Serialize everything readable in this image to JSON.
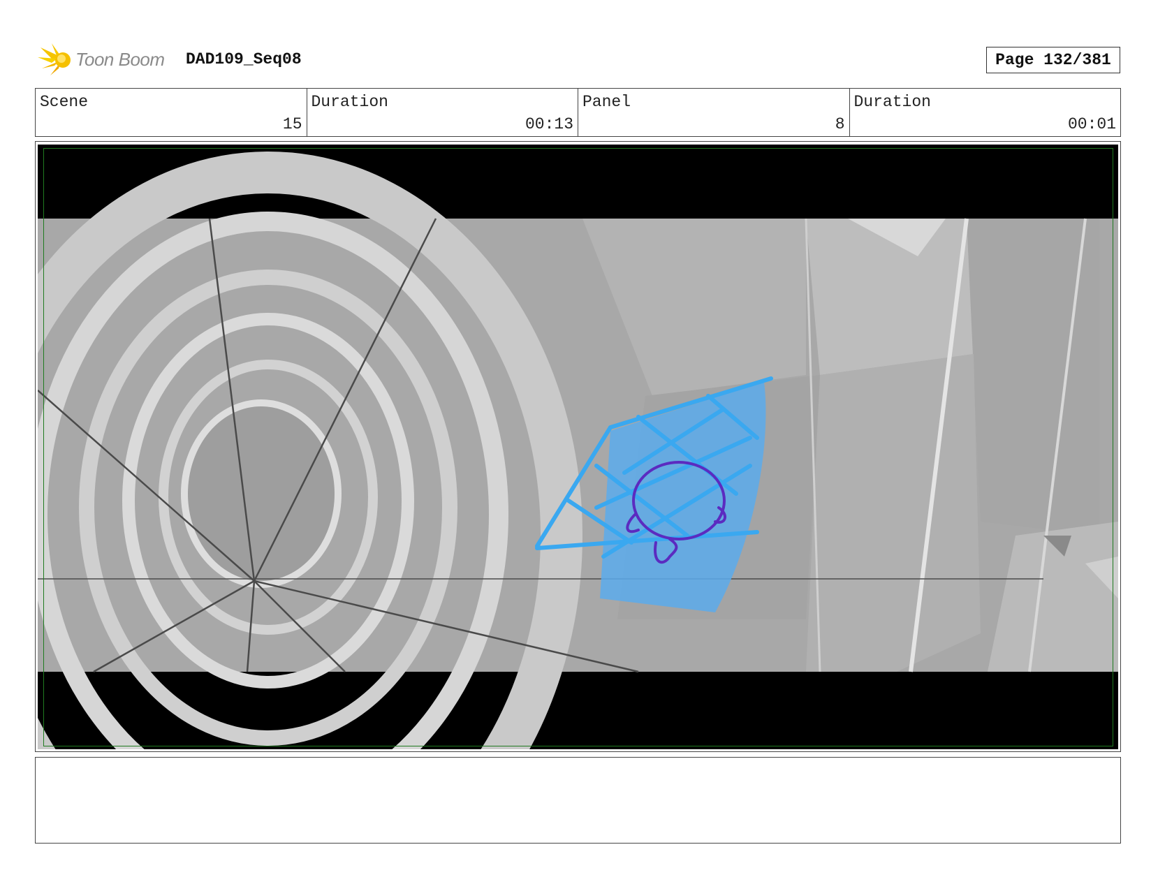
{
  "header": {
    "brand": "Toon Boom",
    "document_title": "DAD109_Seq08",
    "page_label": "Page 132/381"
  },
  "info": [
    {
      "label": "Scene",
      "value": "15"
    },
    {
      "label": "Duration",
      "value": "00:13"
    },
    {
      "label": "Panel",
      "value": "8"
    },
    {
      "label": "Duration",
      "value": "00:01"
    }
  ],
  "panel": {
    "description": "",
    "notes": ""
  },
  "colors": {
    "letterbox": "#000000",
    "safe_frame": "#1f7a1f",
    "scene_gray": "#a9a9a9",
    "sketch_blue": "#3aa8f0",
    "character_purple": "#5b2bc0"
  },
  "icons": {
    "logo": "toon-boom-starburst-logo"
  }
}
